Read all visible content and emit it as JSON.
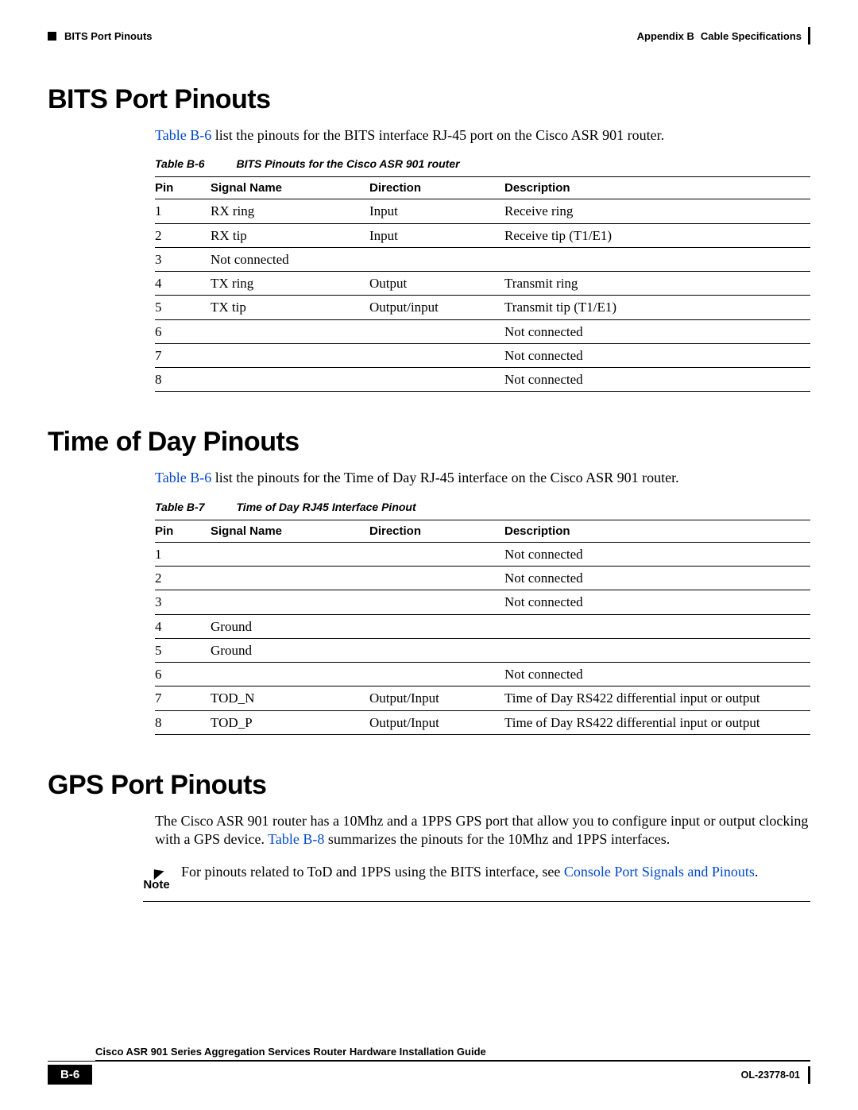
{
  "header": {
    "section": "BITS Port Pinouts",
    "appendix": "Appendix B",
    "appendix_title": "Cable Specifications"
  },
  "sec1": {
    "heading": "BITS Port Pinouts",
    "intro_link": "Table B-6",
    "intro_rest": " list the pinouts for the BITS interface RJ-45 port on the Cisco ASR 901 router.",
    "table_no": "Table B-6",
    "table_title": "BITS Pinouts for the Cisco ASR 901 router",
    "cols": {
      "pin": "Pin",
      "signal": "Signal Name",
      "dir": "Direction",
      "desc": "Description"
    },
    "rows": [
      {
        "pin": "1",
        "signal": "RX ring",
        "dir": "Input",
        "desc": "Receive ring"
      },
      {
        "pin": "2",
        "signal": "RX tip",
        "dir": "Input",
        "desc": "Receive tip (T1/E1)"
      },
      {
        "pin": "3",
        "signal": "Not connected",
        "dir": "",
        "desc": ""
      },
      {
        "pin": "4",
        "signal": "TX ring",
        "dir": "Output",
        "desc": "Transmit ring"
      },
      {
        "pin": "5",
        "signal": "TX tip",
        "dir": "Output/input",
        "desc": "Transmit tip (T1/E1)"
      },
      {
        "pin": "6",
        "signal": "",
        "dir": "",
        "desc": "Not connected"
      },
      {
        "pin": "7",
        "signal": "",
        "dir": "",
        "desc": "Not connected"
      },
      {
        "pin": "8",
        "signal": "",
        "dir": "",
        "desc": "Not connected"
      }
    ]
  },
  "sec2": {
    "heading": "Time of Day Pinouts",
    "intro_link": "Table B-6",
    "intro_rest": " list the pinouts for the Time of Day RJ-45 interface on the Cisco ASR 901 router.",
    "table_no": "Table B-7",
    "table_title": "Time of Day RJ45 Interface Pinout",
    "cols": {
      "pin": "Pin",
      "signal": "Signal Name",
      "dir": "Direction",
      "desc": "Description"
    },
    "rows": [
      {
        "pin": "1",
        "signal": "",
        "dir": "",
        "desc": "Not connected"
      },
      {
        "pin": "2",
        "signal": "",
        "dir": "",
        "desc": "Not connected"
      },
      {
        "pin": "3",
        "signal": "",
        "dir": "",
        "desc": "Not connected"
      },
      {
        "pin": "4",
        "signal": "Ground",
        "dir": "",
        "desc": ""
      },
      {
        "pin": "5",
        "signal": "Ground",
        "dir": "",
        "desc": ""
      },
      {
        "pin": "6",
        "signal": "",
        "dir": "",
        "desc": "Not connected"
      },
      {
        "pin": "7",
        "signal": "TOD_N",
        "dir": "Output/Input",
        "desc": "Time of Day RS422 differential input or output"
      },
      {
        "pin": "8",
        "signal": "TOD_P",
        "dir": "Output/Input",
        "desc": "Time of Day RS422 differential input or output"
      }
    ]
  },
  "sec3": {
    "heading": "GPS Port Pinouts",
    "p1a": "The Cisco ASR 901 router has a 10Mhz and a 1PPS GPS port that allow you to configure input or output clocking with a GPS device. ",
    "p1link": "Table B-8",
    "p1b": " summarizes the pinouts for the 10Mhz and 1PPS interfaces.",
    "note_label": "Note",
    "note_a": "For pinouts related to ToD and 1PPS using the BITS interface, see ",
    "note_link": "Console Port Signals and Pinouts",
    "note_b": "."
  },
  "footer": {
    "doc": "Cisco ASR 901 Series Aggregation Services Router Hardware Installation Guide",
    "page": "B-6",
    "ol": "OL-23778-01"
  }
}
